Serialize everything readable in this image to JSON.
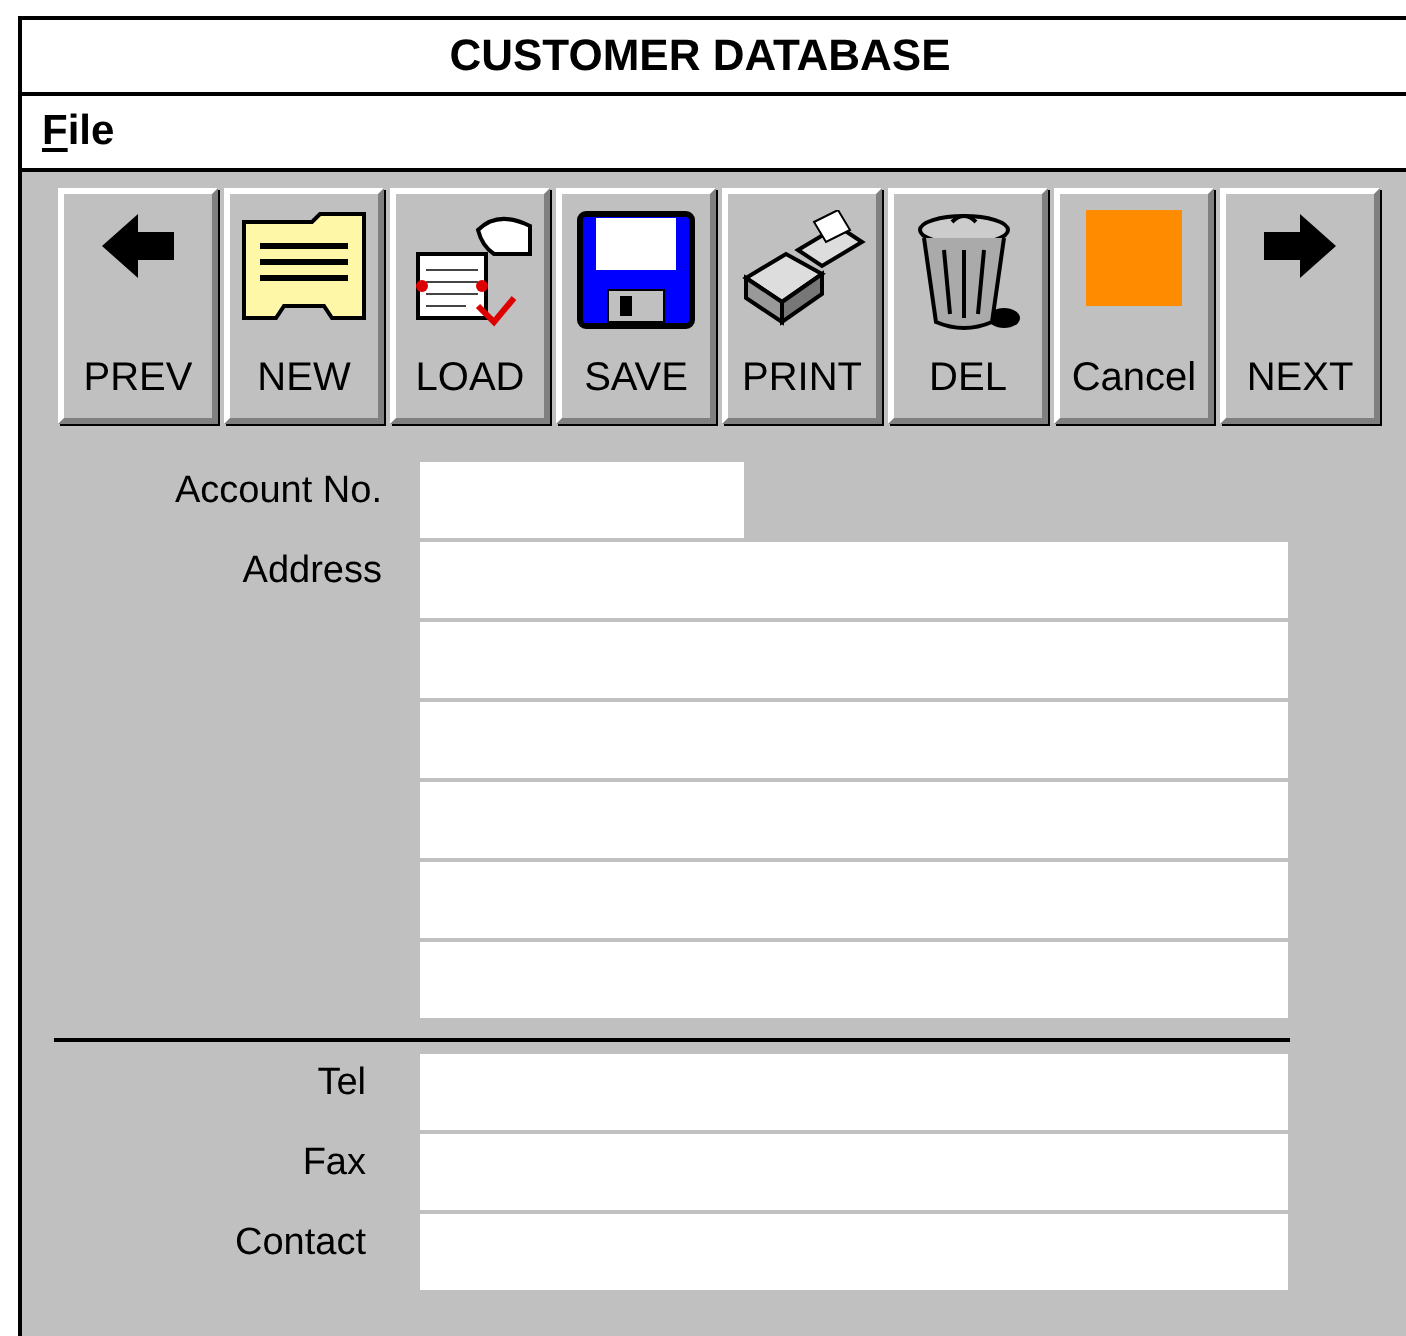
{
  "window": {
    "title": "CUSTOMER DATABASE"
  },
  "menu": [
    {
      "label_parts": [
        {
          "text": "F",
          "underlined": true
        },
        {
          "text": "ile",
          "underlined": false
        }
      ]
    }
  ],
  "toolbar": [
    {
      "label": "PREV",
      "kind": "prev"
    },
    {
      "label": "NEW",
      "kind": "new"
    },
    {
      "label": "LOAD",
      "kind": "load"
    },
    {
      "label": "SAVE",
      "kind": "save"
    },
    {
      "label": "PRINT",
      "kind": "print"
    },
    {
      "label": "DEL",
      "kind": "delete"
    },
    {
      "label": "Cancel",
      "kind": "cancel"
    },
    {
      "label": "NEXT",
      "kind": "next"
    }
  ],
  "sections": [
    {
      "fields": [
        {
          "label": "Account No.",
          "kind": "short"
        },
        {
          "label": "Address",
          "kind": "address"
        }
      ]
    },
    {
      "fields": [
        {
          "label": "Tel",
          "kind": "line"
        },
        {
          "label": "Fax",
          "kind": "line"
        },
        {
          "label": "Contact",
          "kind": "line"
        }
      ]
    }
  ]
}
